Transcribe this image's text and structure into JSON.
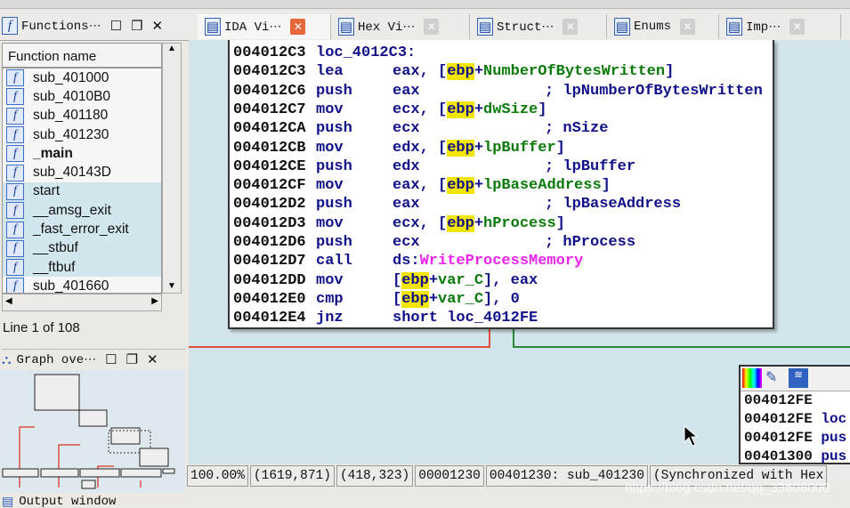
{
  "functions_panel": {
    "title": "Functions⋯",
    "column_header": "Function name",
    "status": "Line 1 of 108",
    "items": [
      {
        "name": "sub_401000",
        "lib": false
      },
      {
        "name": "sub_4010B0",
        "lib": false
      },
      {
        "name": "sub_401180",
        "lib": false
      },
      {
        "name": "sub_401230",
        "lib": false
      },
      {
        "name": "_main",
        "lib": false,
        "bold": true
      },
      {
        "name": "sub_40143D",
        "lib": false
      },
      {
        "name": "start",
        "lib": true
      },
      {
        "name": "__amsg_exit",
        "lib": true
      },
      {
        "name": "_fast_error_exit",
        "lib": true
      },
      {
        "name": "__stbuf",
        "lib": true
      },
      {
        "name": "__ftbuf",
        "lib": true
      },
      {
        "name": "sub_401660",
        "lib": false
      }
    ]
  },
  "graph_overview": {
    "title": "Graph ove⋯"
  },
  "output_window": {
    "title": "Output window"
  },
  "tabs": [
    {
      "label": "IDA Vi⋯",
      "active": true
    },
    {
      "label": "Hex Vi⋯"
    },
    {
      "label": "Struct⋯"
    },
    {
      "label": "Enums"
    },
    {
      "label": "Imp⋯"
    }
  ],
  "code": [
    {
      "addr": "004012C3",
      "mn": "loc_4012C3:",
      "op": "",
      "cm": ""
    },
    {
      "addr": "004012C3",
      "mn": "lea",
      "op": [
        "eax, [",
        "ebp",
        "+",
        "NumberOfBytesWritten",
        "]"
      ],
      "cm": ""
    },
    {
      "addr": "004012C6",
      "mn": "push",
      "op": "eax",
      "cm": "; lpNumberOfBytesWritten"
    },
    {
      "addr": "004012C7",
      "mn": "mov",
      "op": [
        "ecx, [",
        "ebp",
        "+",
        "dwSize",
        "]"
      ],
      "cm": ""
    },
    {
      "addr": "004012CA",
      "mn": "push",
      "op": "ecx",
      "cm": "; nSize"
    },
    {
      "addr": "004012CB",
      "mn": "mov",
      "op": [
        "edx, [",
        "ebp",
        "+",
        "lpBuffer",
        "]"
      ],
      "cm": ""
    },
    {
      "addr": "004012CE",
      "mn": "push",
      "op": "edx",
      "cm": "; lpBuffer"
    },
    {
      "addr": "004012CF",
      "mn": "mov",
      "op": [
        "eax, [",
        "ebp",
        "+",
        "lpBaseAddress",
        "]"
      ],
      "cm": ""
    },
    {
      "addr": "004012D2",
      "mn": "push",
      "op": "eax",
      "cm": "; lpBaseAddress"
    },
    {
      "addr": "004012D3",
      "mn": "mov",
      "op": [
        "ecx, [",
        "ebp",
        "+",
        "hProcess",
        "]"
      ],
      "cm": ""
    },
    {
      "addr": "004012D6",
      "mn": "push",
      "op": "ecx",
      "cm": "; hProcess"
    },
    {
      "addr": "004012D7",
      "mn": "call",
      "op": [
        "ds:",
        "WriteProcessMemory"
      ],
      "cm": ""
    },
    {
      "addr": "004012DD",
      "mn": "mov",
      "op": [
        "[",
        "ebp",
        "+",
        "var_C",
        "], eax"
      ],
      "cm": ""
    },
    {
      "addr": "004012E0",
      "mn": "cmp",
      "op": [
        "[",
        "ebp",
        "+",
        "var_C",
        "], 0"
      ],
      "cm": ""
    },
    {
      "addr": "004012E4",
      "mn": "jnz",
      "op": "short loc_4012FE",
      "cm": ""
    }
  ],
  "mini_block": [
    {
      "addr": "004012FE",
      "txt": ""
    },
    {
      "addr": "004012FE",
      "txt": "loc"
    },
    {
      "addr": "004012FE",
      "txt": "pus"
    },
    {
      "addr": "00401300",
      "txt": "pus"
    }
  ],
  "statusbar": [
    "100.00%",
    "(1619,871)",
    "(418,323)",
    "00001230",
    "00401230: sub_401230",
    "(Synchronized with Hex"
  ],
  "watermark": "https://blog.csdn.net/qq_33608000",
  "colors": {
    "graph_bg": "#d3e5ec",
    "highlight": "#f2e600",
    "import": "#ee22ee",
    "var": "#0a7a0a",
    "edge_false": "#e05040",
    "edge_true": "#2a8a3a"
  }
}
